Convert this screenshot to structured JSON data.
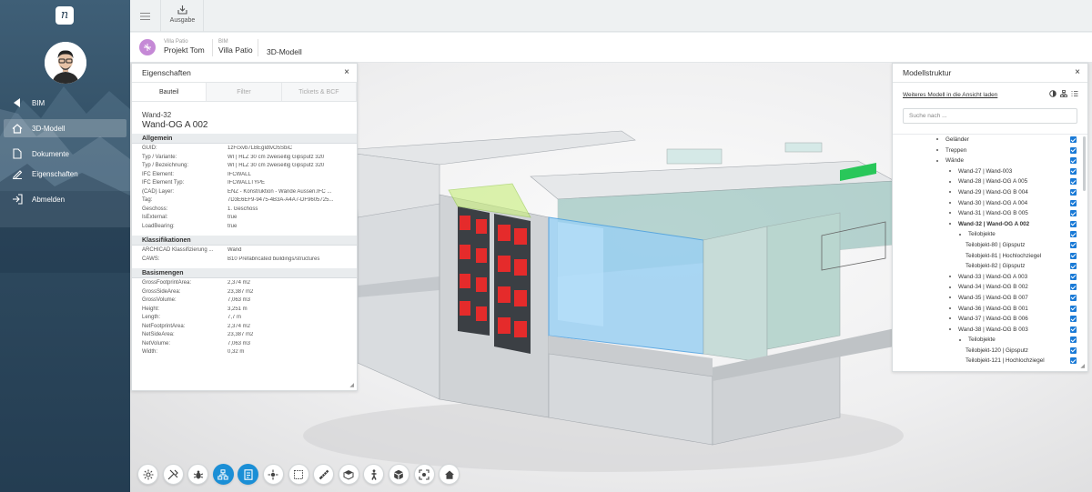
{
  "app": {
    "colors": {
      "sidebar": "#2f4b60",
      "accent": "#1b8fd6",
      "project_badge": "#c589d6",
      "checkbox": "#1a7ad6"
    }
  },
  "sidebar": {
    "logo_glyph": "n",
    "items": [
      {
        "label": "BIM",
        "icon": "back-arrow-icon"
      },
      {
        "label": "3D-Modell",
        "icon": "home-icon",
        "active": true
      },
      {
        "label": "Dokumente",
        "icon": "document-icon"
      },
      {
        "label": "Eigenschaften",
        "icon": "pencil-icon"
      },
      {
        "label": "Abmelden",
        "icon": "logout-icon"
      }
    ]
  },
  "topbar": {
    "ausgabe_label": "Ausgabe"
  },
  "breadcrumb": {
    "project_small": "Villa Patio",
    "project_big": "Projekt Tom",
    "bim_small": "BIM",
    "bim_big": "Villa Patio",
    "current": "3D-Modell"
  },
  "properties": {
    "title": "Eigenschaften",
    "close": "×",
    "tabs": [
      "Bauteil",
      "Filter",
      "Tickets & BCF"
    ],
    "object_type": "Wand-32",
    "object_name": "Wand-OG A 002",
    "sections": [
      {
        "title": "Allgemein",
        "rows": [
          [
            "GUID:",
            "1zFcxvb7LBEgIdtvO5SbiC"
          ],
          [
            "Typ / Variante:",
            "WI | HLZ 30 cm zweiseitig Gipsputz 320"
          ],
          [
            "Typ / Bezeichnung:",
            "WI | HLZ 30 cm zweiseitig Gipsputz 320"
          ],
          [
            "IFC Element:",
            "IFCWALL"
          ],
          [
            "IFC Element Typ:",
            "IFCWALLTYPE"
          ],
          [
            "(CAD) Layer:",
            "ENZ - Konstruktion - Wände Aussen.IFC ..."
          ],
          [
            "Tag:",
            "7D3E6EF9-9475-4B3A-A4A7-DF9605725..."
          ],
          [
            "Geschoss:",
            "1. Geschoss"
          ],
          [
            "IsExternal:",
            "true"
          ],
          [
            "LoadBearing:",
            "true"
          ]
        ]
      },
      {
        "title": "Klassifikationen",
        "rows": [
          [
            "ARCHICAD Klassifizierung ...",
            "Wand"
          ],
          [
            "CAWS:",
            "B10 Prefabricated buildings/structures"
          ]
        ]
      },
      {
        "title": "Basismengen",
        "rows": [
          [
            "GrossFootprintArea:",
            "2,374 m2"
          ],
          [
            "GrossSideArea:",
            "23,387 m2"
          ],
          [
            "GrossVolume:",
            "7,063 m3"
          ],
          [
            "Height:",
            "3,251 m"
          ],
          [
            "Length:",
            "7,7 m"
          ],
          [
            "NetFootprintArea:",
            "2,374 m2"
          ],
          [
            "NetSideArea:",
            "23,387 m2"
          ],
          [
            "NetVolume:",
            "7,063 m3"
          ],
          [
            "Width:",
            "0,32 m"
          ]
        ]
      }
    ]
  },
  "tree": {
    "title": "Modellstruktur",
    "close": "×",
    "load_link": "Weiteres Modell in die Ansicht laden",
    "search_placeholder": "Suche nach ...",
    "rows": [
      {
        "label": "Geländer",
        "level": 0
      },
      {
        "label": "Treppen",
        "level": 0
      },
      {
        "label": "Wände",
        "level": 0
      },
      {
        "label": "Wand-27 | Wand-003",
        "level": 1
      },
      {
        "label": "Wand-28 | Wand-OG A 005",
        "level": 1
      },
      {
        "label": "Wand-29 | Wand-OG B 004",
        "level": 1
      },
      {
        "label": "Wand-30 | Wand-OG A 004",
        "level": 1
      },
      {
        "label": "Wand-31 | Wand-OG B 005",
        "level": 1
      },
      {
        "label": "Wand-32 | Wand-OG A 002",
        "level": 1,
        "bold": true
      },
      {
        "label": "Teilobjekte",
        "level": 2
      },
      {
        "label": "Teilobjekt-80 | Gipsputz",
        "level": 3
      },
      {
        "label": "Teilobjekt-81 | Hochlochziegel",
        "level": 3
      },
      {
        "label": "Teilobjekt-82 | Gipsputz",
        "level": 3
      },
      {
        "label": "Wand-33 | Wand-OG A 003",
        "level": 1
      },
      {
        "label": "Wand-34 | Wand-OG B 002",
        "level": 1
      },
      {
        "label": "Wand-35 | Wand-OG B 007",
        "level": 1
      },
      {
        "label": "Wand-36 | Wand-OG B 001",
        "level": 1
      },
      {
        "label": "Wand-37 | Wand-OG B 006",
        "level": 1
      },
      {
        "label": "Wand-38 | Wand-OG B 003",
        "level": 1
      },
      {
        "label": "Teilobjekte",
        "level": 2
      },
      {
        "label": "Teilobjekt-120 | Gipsputz",
        "level": 3
      },
      {
        "label": "Teilobjekt-121 | Hochlochziegel",
        "level": 3
      }
    ]
  },
  "toolbar": {
    "buttons": [
      {
        "name": "settings-icon",
        "active": false
      },
      {
        "name": "tools-icon",
        "active": false
      },
      {
        "name": "bug-icon",
        "active": false
      },
      {
        "name": "model-tree-icon",
        "active": true
      },
      {
        "name": "properties-icon",
        "active": true
      },
      {
        "name": "focus-icon",
        "active": false
      },
      {
        "name": "selection-box-icon",
        "active": false
      },
      {
        "name": "measure-icon",
        "active": false
      },
      {
        "name": "section-icon",
        "active": false
      },
      {
        "name": "walk-person-icon",
        "active": false
      },
      {
        "name": "explode-cube-icon",
        "active": false
      },
      {
        "name": "fit-view-icon",
        "active": false
      },
      {
        "name": "home-view-icon",
        "active": false
      }
    ]
  }
}
